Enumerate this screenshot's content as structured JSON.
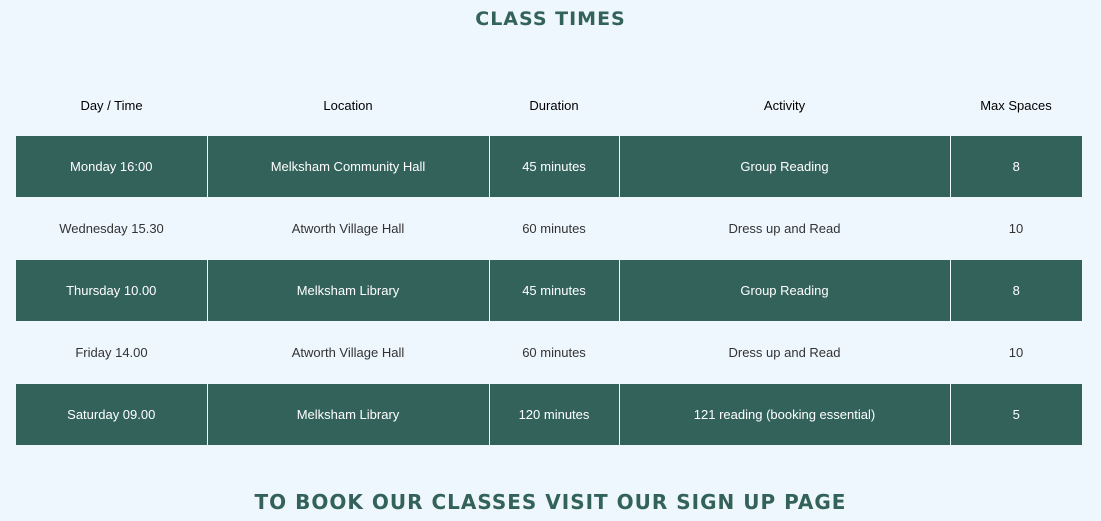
{
  "header": {
    "title": "CLASS TIMES"
  },
  "table": {
    "columns": [
      "Day / Time",
      "Location",
      "Duration",
      "Activity",
      "Max Spaces"
    ],
    "rows": [
      [
        "Monday 16:00",
        "Melksham Community Hall",
        "45 minutes",
        "Group Reading",
        "8"
      ],
      [
        "Wednesday 15.30",
        "Atworth Village Hall",
        "60 minutes",
        "Dress up and Read",
        "10"
      ],
      [
        "Thursday 10.00",
        "Melksham Library",
        "45 minutes",
        "Group Reading",
        "8"
      ],
      [
        "Friday 14.00",
        "Atworth Village Hall",
        "60 minutes",
        "Dress up and Read",
        "10"
      ],
      [
        "Saturday 09.00",
        "Melksham Library",
        "120 minutes",
        "121 reading (booking essential)",
        "5"
      ]
    ]
  },
  "footer": {
    "cta": "TO BOOK OUR CLASSES VISIT OUR SIGN UP PAGE"
  },
  "colors": {
    "background": "#eef6fe",
    "accent": "#33625b",
    "row_text_light": "#ffffff"
  }
}
